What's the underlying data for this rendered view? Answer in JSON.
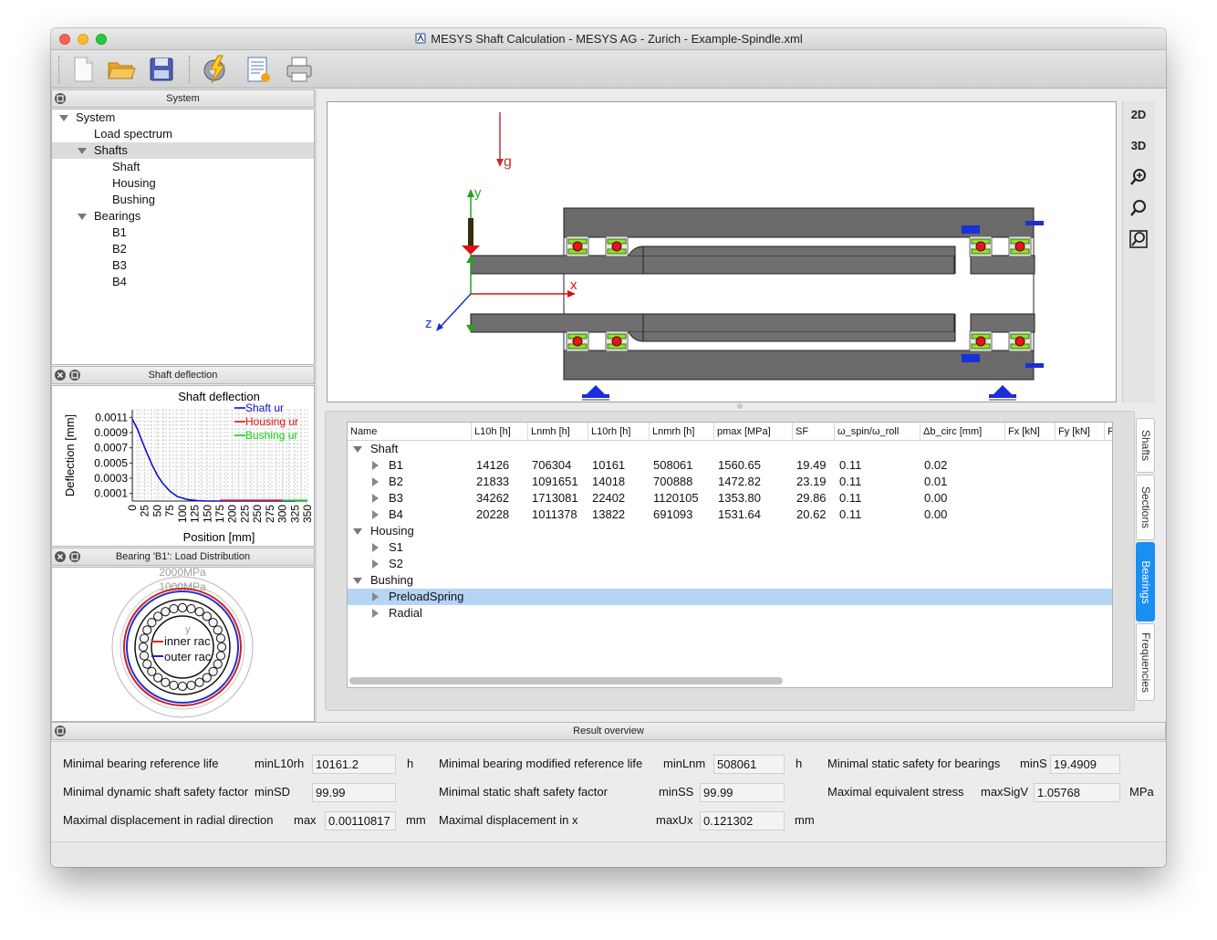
{
  "window": {
    "title": "MESYS Shaft Calculation - MESYS AG - Zurich - Example-Spindle.xml"
  },
  "toolbar": {
    "icons": [
      "new-file-icon",
      "open-folder-icon",
      "save-icon",
      "calculate-icon",
      "report-icon",
      "print-icon"
    ]
  },
  "system_panel": {
    "title": "System",
    "tree": [
      {
        "label": "System",
        "level": 0,
        "expanded": true
      },
      {
        "label": "Load spectrum",
        "level": 1
      },
      {
        "label": "Shafts",
        "level": 1,
        "expanded": true,
        "selected": true
      },
      {
        "label": "Shaft",
        "level": 2
      },
      {
        "label": "Housing",
        "level": 2
      },
      {
        "label": "Bushing",
        "level": 2
      },
      {
        "label": "Bearings",
        "level": 1,
        "expanded": true
      },
      {
        "label": "B1",
        "level": 2
      },
      {
        "label": "B2",
        "level": 2
      },
      {
        "label": "B3",
        "level": 2
      },
      {
        "label": "B4",
        "level": 2
      }
    ]
  },
  "deflection_panel": {
    "title": "Shaft deflection",
    "chart_data": {
      "type": "line",
      "title": "Shaft deflection",
      "xlabel": "Position [mm]",
      "ylabel": "Deflection [mm]",
      "xlim": [
        0,
        350
      ],
      "ylim": [
        0,
        0.0012
      ],
      "xticks": [
        "0",
        "25",
        "50",
        "75",
        "100",
        "125",
        "150",
        "175",
        "200",
        "225",
        "250",
        "275",
        "300",
        "325",
        "350"
      ],
      "yticks": [
        "0.0001",
        "0.0003",
        "0.0005",
        "0.0007",
        "0.0009",
        "0.0011"
      ],
      "grid": true,
      "legend": "top-right",
      "series": [
        {
          "name": "Shaft ur",
          "color": "#1010c8",
          "x": [
            0,
            10,
            20,
            30,
            40,
            50,
            60,
            75,
            90,
            110,
            130,
            150,
            170,
            200,
            250,
            300,
            325
          ],
          "y": [
            0.00108,
            0.00095,
            0.00078,
            0.00062,
            0.00047,
            0.00034,
            0.00024,
            0.00013,
            6e-05,
            2e-05,
            5e-06,
            0.0,
            0.0,
            0.0,
            0.0,
            0.0,
            0.0
          ]
        },
        {
          "name": "Housing ur",
          "color": "#e01010",
          "x": [
            175,
            200,
            250,
            300
          ],
          "y": [
            1e-05,
            1e-05,
            1e-05,
            1e-05
          ]
        },
        {
          "name": "Bushing ur",
          "color": "#10d010",
          "x": [
            300,
            325,
            350
          ],
          "y": [
            1e-05,
            1e-05,
            1e-05
          ]
        }
      ]
    }
  },
  "load_panel": {
    "title": "Bearing 'B1': Load Distribution",
    "labels": {
      "scale_outer": "2000MPa",
      "scale_inner": "1000MPa",
      "y_axis": "y",
      "inner": "inner rac",
      "outer": "outer rac"
    }
  },
  "view_buttons": {
    "view2d": "2D",
    "view3d": "3D"
  },
  "gravity_label": "g",
  "axes_labels": {
    "x": "x",
    "y": "y",
    "z": "z"
  },
  "results_table": {
    "columns": [
      "Name",
      "L10h [h]",
      "Lnmh [h]",
      "L10rh [h]",
      "Lnmrh [h]",
      "pmax [MPa]",
      "SF",
      "ω_spin/ω_roll",
      "Δb_circ [mm]",
      "Fx [kN]",
      "Fy [kN]",
      "F"
    ],
    "groups": [
      {
        "name": "Shaft",
        "rows": [
          {
            "name": "B1",
            "values": [
              "14126",
              "706304",
              "10161",
              "508061",
              "1560.65",
              "19.49",
              "0.11",
              "0.02"
            ]
          },
          {
            "name": "B2",
            "values": [
              "21833",
              "1091651",
              "14018",
              "700888",
              "1472.82",
              "23.19",
              "0.11",
              "0.01"
            ]
          },
          {
            "name": "B3",
            "values": [
              "34262",
              "1713081",
              "22402",
              "1120105",
              "1353.80",
              "29.86",
              "0.11",
              "0.00"
            ]
          },
          {
            "name": "B4",
            "values": [
              "20228",
              "1011378",
              "13822",
              "691093",
              "1531.64",
              "20.62",
              "0.11",
              "0.00"
            ]
          }
        ]
      },
      {
        "name": "Housing",
        "rows": [
          {
            "name": "S1"
          },
          {
            "name": "S2"
          }
        ]
      },
      {
        "name": "Bushing",
        "rows": [
          {
            "name": "PreloadSpring",
            "selected": true
          },
          {
            "name": "Radial"
          }
        ]
      }
    ]
  },
  "side_tabs": [
    {
      "label": "Shafts",
      "active": false
    },
    {
      "label": "Sections",
      "active": false
    },
    {
      "label": "Bearings",
      "active": true
    },
    {
      "label": "Frequencies",
      "active": false
    }
  ],
  "result_overview": {
    "title": "Result overview",
    "items": [
      {
        "label": "Minimal bearing reference life",
        "sym": "minL10rh",
        "value": "10161.2",
        "unit": "h"
      },
      {
        "label": "Minimal bearing modified reference life",
        "sym": "minLnm",
        "value": "508061",
        "unit": "h"
      },
      {
        "label": "Minimal static safety for bearings",
        "sym": "minS",
        "value": "19.4909",
        "unit": ""
      },
      {
        "label": "Minimal dynamic shaft safety factor",
        "sym": "minSD",
        "value": "99.99",
        "unit": ""
      },
      {
        "label": "Minimal static shaft safety factor",
        "sym": "minSS",
        "value": "99.99",
        "unit": ""
      },
      {
        "label": "Maximal equivalent stress",
        "sym": "maxSigV",
        "value": "1.05768",
        "unit": "MPa"
      },
      {
        "label": "Maximal displacement in radial direction",
        "sym": "max",
        "value": "0.00110817",
        "unit": "mm"
      },
      {
        "label": "Maximal displacement in x",
        "sym": "maxUx",
        "value": "0.121302",
        "unit": "mm"
      }
    ]
  }
}
